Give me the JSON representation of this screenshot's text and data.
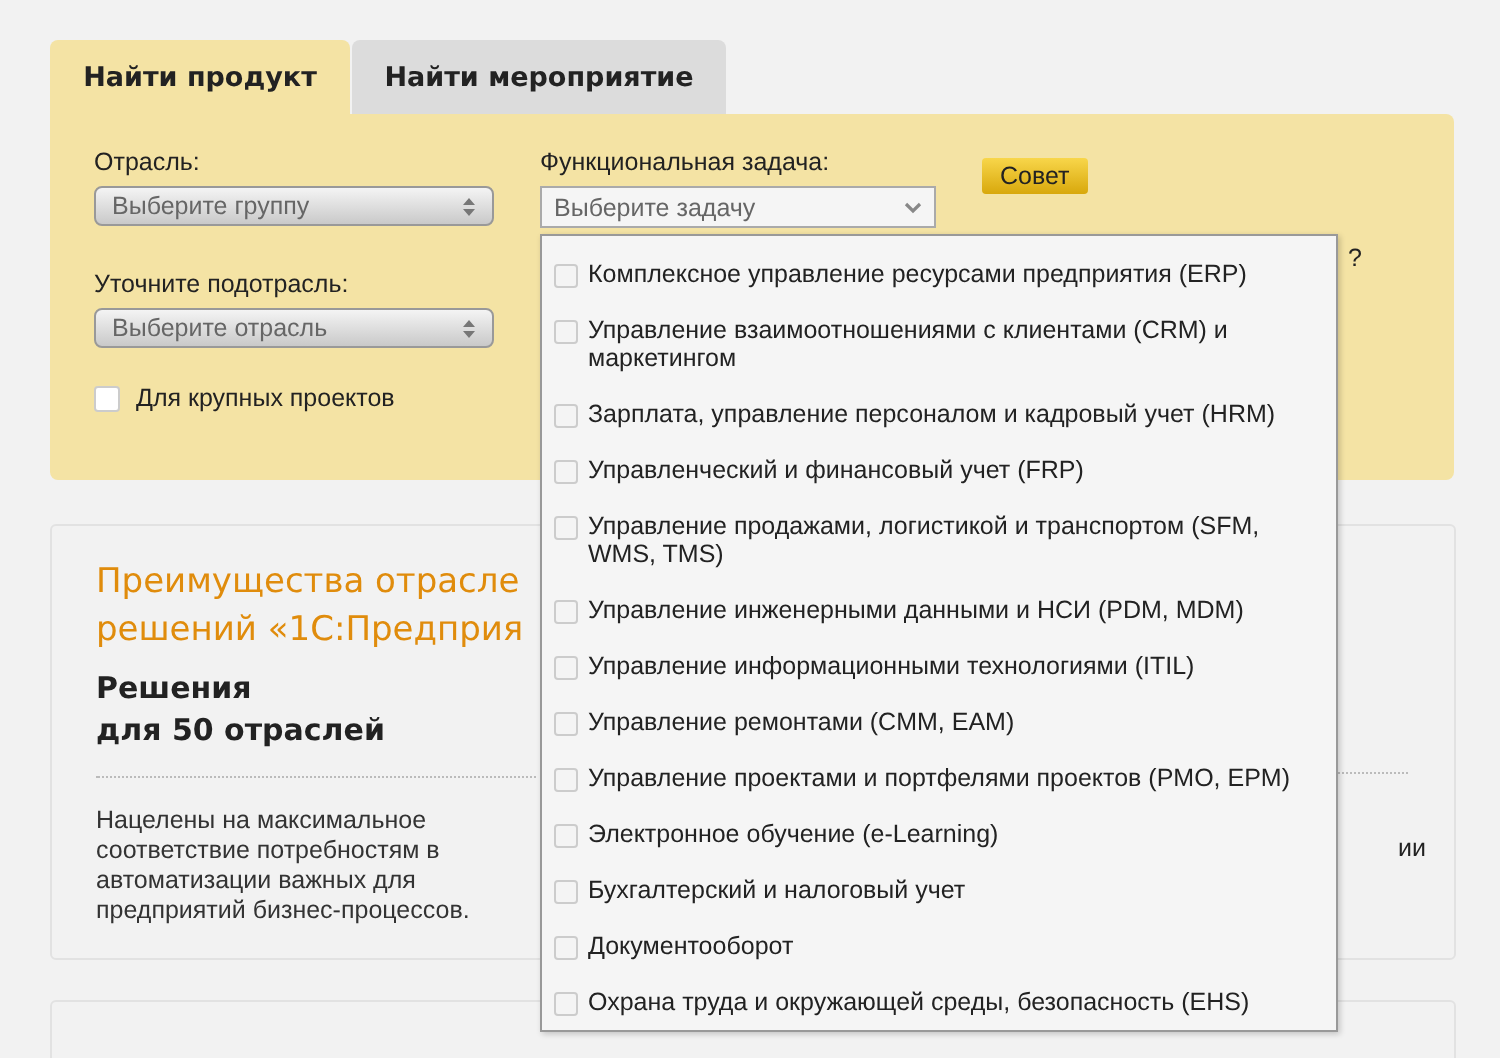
{
  "tabs": [
    {
      "label": "Найти продукт",
      "selected": true
    },
    {
      "label": "Найти мероприятие",
      "selected": false
    }
  ],
  "filters": {
    "industry_label": "Отрасль:",
    "industry_placeholder": "Выберите группу",
    "subindustry_label": "Уточните подотрасль:",
    "subindustry_placeholder": "Выберите отрасль",
    "large_projects": {
      "label": "Для крупных проектов",
      "checked": false
    },
    "task_label": "Функциональная задача:",
    "task_placeholder": "Выберите задачу"
  },
  "tip": {
    "badge": "Совет",
    "line_2_end": "?"
  },
  "task_options": [
    {
      "label": "Комплексное управление ресурсами предприятия (ERP)",
      "checked": false
    },
    {
      "label": "Управление взаимоотношениями с клиентами (CRM) и маркетингом",
      "checked": false
    },
    {
      "label": "Зарплата, управление персоналом и кадровый учет (HRM)",
      "checked": false
    },
    {
      "label": "Управленческий и финансовый учет (FRP)",
      "checked": false
    },
    {
      "label": "Управление продажами, логистикой и транспортом (SFM, WMS, TMS)",
      "checked": false
    },
    {
      "label": "Управление инженерными данными и НСИ (PDM, MDM)",
      "checked": false
    },
    {
      "label": "Управление информационными технологиями (ITIL)",
      "checked": false
    },
    {
      "label": "Управление ремонтами (CMM, EAM)",
      "checked": false
    },
    {
      "label": "Управление проектами и портфелями проектов (PMO, EPM)",
      "checked": false
    },
    {
      "label": "Электронное обучение (e-Learning)",
      "checked": false
    },
    {
      "label": "Бухгалтерский и налоговый учет",
      "checked": false
    },
    {
      "label": "Документооборот",
      "checked": false
    },
    {
      "label": "Охрана труда и окружающей среды, безопасность (EHS)",
      "checked": false
    }
  ],
  "benefits": {
    "title_lines": [
      "Преимущества отрасле",
      "решений «1С:Предприя"
    ],
    "subtitle_lines": [
      "Решения",
      "для 50 отраслей"
    ],
    "description": "Нацелены на максимальное соответствие потребностям в автоматизации важных для предприятий бизнес-процессов.",
    "column_2_fragment": "ии"
  }
}
